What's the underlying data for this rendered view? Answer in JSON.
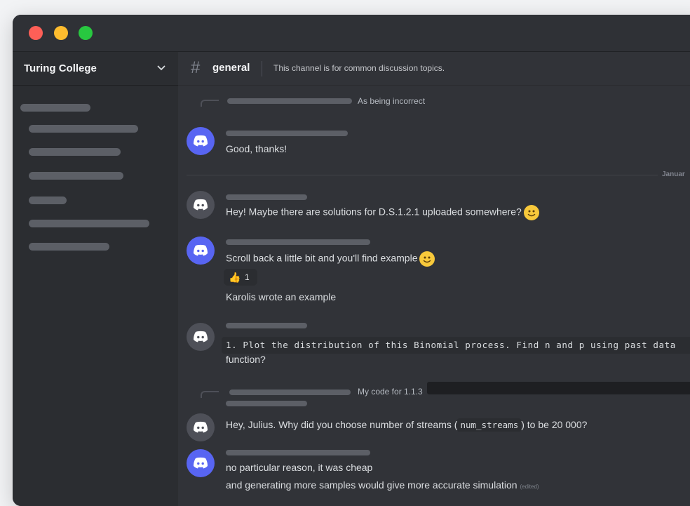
{
  "window": {
    "traffic_lights": [
      "close",
      "minimize",
      "zoom"
    ]
  },
  "server": {
    "name": "Turing College",
    "dropdown_icon": "chevron-down-icon"
  },
  "channel": {
    "hash": "#",
    "name": "general",
    "topic": "This channel is for common discussion topics."
  },
  "date_divider": "Januar",
  "messages": [
    {
      "reply_to": "As being incorrect",
      "text": "Good, thanks!",
      "avatar_color": "#5865f2"
    },
    {
      "text_before_emoji": "Hey! Maybe there are solutions for D.S.1.2.1 uploaded somewhere?",
      "emoji": "slightly-smiling-face",
      "avatar_color": "#4e5058"
    },
    {
      "text_before_emoji": "Scroll back a little bit and you'll find example",
      "emoji": "slightly-smiling-face",
      "reaction": {
        "emoji": "👍",
        "count": "1"
      },
      "followup": "Karolis wrote an example",
      "avatar_color": "#5865f2"
    },
    {
      "code": "1. Plot the distribution of this Binomial process. Find n and p using past data",
      "text": "function?",
      "avatar_color": "#4e5058"
    },
    {
      "reply_to": "My code for 1.1.3",
      "text_before_code": "Hey, Julius. Why did you choose number of streams (",
      "inline_code": "num_streams",
      "text_after_code": ") to be 20 000?",
      "avatar_color": "#4e5058"
    },
    {
      "text": "no particular reason, it was cheap",
      "followup": "and generating more samples would give more accurate simulation",
      "edited": "(edited)",
      "avatar_color": "#5865f2"
    }
  ]
}
